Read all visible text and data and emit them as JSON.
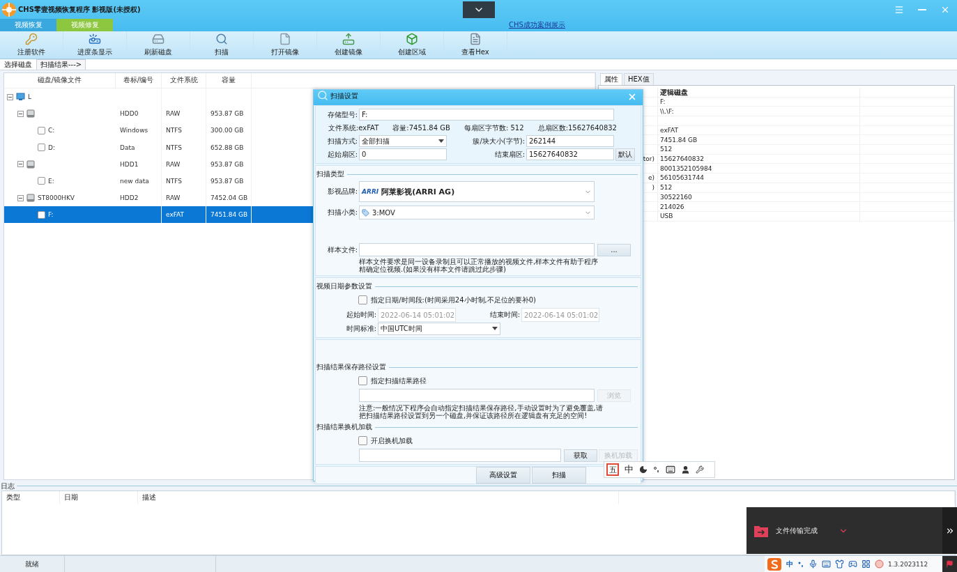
{
  "window": {
    "title": "CHS零壹视频恢复程序 影视版(未授权)"
  },
  "mode_tabs": [
    {
      "label": "视频恢复",
      "selected": false
    },
    {
      "label": "视频修复",
      "selected": true
    }
  ],
  "case_link": "CHS成功案例展示",
  "toolbar": [
    {
      "label": "注册软件",
      "kind": "key"
    },
    {
      "label": "进度条显示",
      "kind": "projector"
    },
    {
      "label": "刷新磁盘",
      "kind": "refresh"
    },
    {
      "label": "扫描",
      "kind": "scan"
    },
    {
      "label": "打开镜像",
      "kind": "open"
    },
    {
      "label": "创建镜像",
      "kind": "create"
    },
    {
      "label": "创建区域",
      "kind": "region"
    },
    {
      "label": "查看Hex",
      "kind": "hex"
    }
  ],
  "view_tabs": [
    {
      "label": "选择磁盘",
      "selected": true
    },
    {
      "label": "扫描结果--->",
      "selected": false
    }
  ],
  "disk_table": {
    "columns": [
      "磁盘/镜像文件",
      "卷标/编号",
      "文件系统",
      "容量"
    ],
    "tree": [
      {
        "kind": "computer",
        "name": "L",
        "expanded": true,
        "selected": false,
        "children": [
          {
            "kind": "disk",
            "volume": "HDD0",
            "fs": "RAW",
            "capacity": "953.87 GB",
            "expanded": true,
            "selected": false,
            "children": [
              {
                "kind": "volume",
                "name": "C:",
                "volume": "Windows",
                "fs": "NTFS",
                "capacity": "300.00 GB",
                "checked": false,
                "selected": false
              },
              {
                "kind": "volume",
                "name": "D:",
                "volume": "Data",
                "fs": "NTFS",
                "capacity": "652.88 GB",
                "checked": false,
                "selected": false
              }
            ]
          },
          {
            "kind": "disk",
            "volume": "HDD1",
            "fs": "RAW",
            "capacity": "953.87 GB",
            "expanded": true,
            "selected": false,
            "children": [
              {
                "kind": "volume",
                "name": "E:",
                "volume": "new data",
                "fs": "NTFS",
                "capacity": "953.87 GB",
                "checked": false,
                "selected": false
              }
            ]
          },
          {
            "kind": "disk",
            "name": "ST8000HKV",
            "volume": "HDD2",
            "fs": "RAW",
            "capacity": "7452.04 GB",
            "expanded": true,
            "selected": false,
            "children": [
              {
                "kind": "volume",
                "name": "F:",
                "fs": "exFAT",
                "capacity": "7451.84 GB",
                "checked": false,
                "selected": true
              }
            ]
          }
        ]
      }
    ]
  },
  "properties": {
    "tabs": [
      {
        "label": "属性",
        "selected": true
      },
      {
        "label": "HEX值",
        "selected": false
      }
    ],
    "rows": [
      {
        "value": "逻辑磁盘"
      },
      {
        "value": "F:"
      },
      {
        "value": "\\\\.\\F:"
      },
      {},
      {
        "value": "exFAT"
      },
      {
        "value": "7451.84 GB"
      },
      {
        "value": "512"
      },
      {
        "key": "tor)",
        "value": "15627640832"
      },
      {
        "value": "8001352105984"
      },
      {
        "key": "e)",
        "value": "56105631744"
      },
      {
        "key": ")",
        "value": "512"
      },
      {
        "value": "30522160"
      },
      {
        "value": "214026"
      },
      {
        "value": "USB"
      }
    ]
  },
  "scan_dialog": {
    "title": "扫描设置",
    "device": {
      "label": "存储型号:",
      "value": "F:"
    },
    "info": [
      "文件系统:exFAT",
      "容量:7451.84 GB",
      "每扇区字节数: 512",
      "总扇区数:15627640832"
    ],
    "scan_mode": {
      "label": "扫描方式:",
      "value": "全部扫描"
    },
    "cluster_size": {
      "label": "簇/块大小(字节):",
      "value": "262144"
    },
    "start_sector": {
      "label": "起始扇区:",
      "value": "0"
    },
    "end_sector": {
      "label": "结束扇区:",
      "value": "15627640832"
    },
    "default_button": "默认",
    "scan_type": {
      "heading": "扫描类型",
      "brand_label": "影视品牌:",
      "brand_logo": "ARRI",
      "brand": "阿莱影视(ARRI AG)",
      "subtype_label": "扫描小类:",
      "subtype": "3:MOV",
      "sample_label": "样本文件:",
      "browse_button": "...",
      "sample_note": "样本文件要求是同一设备录制且可以正常播放的视频文件,样本文件有助于程序精确定位视频.(如果没有样本文件请跳过此步骤)"
    },
    "date": {
      "heading": "视频日期参数设置",
      "checkbox": {
        "label": "指定日期/时间段:(时间采用24小时制,不足位的要补0)",
        "checked": false
      },
      "start_label": "起始时间:",
      "start_value": "2022-06-14 05:01:02",
      "end_label": "结束时间:",
      "end_value": "2022-06-14 05:01:02",
      "disabled": true,
      "standard_label": "时间标准:",
      "standard_value": "中国UTC时间"
    },
    "output": {
      "heading": "扫描结果保存路径设置",
      "checkbox": {
        "label": "指定扫描结果路径",
        "checked": false
      },
      "browse_button": {
        "label": "浏览",
        "disabled": true
      },
      "note": "注意:一般情况下程序会自动指定扫描结果保存路径,手动设置时为了避免覆盖,请把扫描结果路径设置到另一个磁盘,并保证该路径所在逻辑盘有充足的空间!"
    },
    "transfer": {
      "heading": "扫描结果换机加载",
      "checkbox": {
        "label": "开启换机加载",
        "checked": false
      },
      "fetch_button": {
        "label": "获取",
        "disabled": false
      },
      "load_button": {
        "label": "换机加载",
        "disabled": true
      }
    },
    "footer_buttons": [
      "高级设置",
      "扫描"
    ]
  },
  "log": {
    "title": "日志",
    "columns": [
      "类型",
      "日期",
      "描述"
    ]
  },
  "status_bar": {
    "status": "就绪",
    "version": "1.3.2023112"
  },
  "ime_bar": {
    "mode": "五",
    "language": "中"
  },
  "tray": {
    "language": "中"
  },
  "notification": {
    "message": "文件传输完成"
  }
}
